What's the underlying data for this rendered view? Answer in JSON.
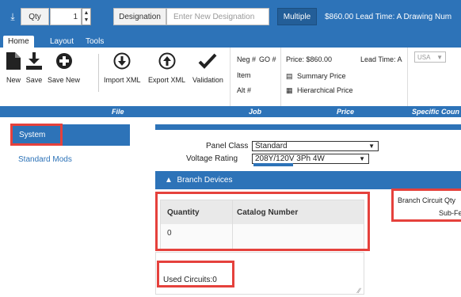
{
  "topbar": {
    "download_icon": "download-icon",
    "qty_label": "Qty",
    "qty_value": "1",
    "designation_label": "Designation",
    "designation_placeholder": "Enter New Designation",
    "multiple_label": "Multiple",
    "info_text": "$860.00  Lead Time: A  Drawing Num"
  },
  "ribbon": {
    "tabs": [
      {
        "label": "Home",
        "active": true
      },
      {
        "label": "Layout",
        "active": false
      },
      {
        "label": "Tools",
        "active": false
      }
    ],
    "file_items": [
      {
        "label": "New",
        "icon": "new-file-icon"
      },
      {
        "label": "Save",
        "icon": "save-download-icon"
      },
      {
        "label": "Save New",
        "icon": "add-circle-icon"
      },
      {
        "label": "Import XML",
        "icon": "import-circle-icon"
      },
      {
        "label": "Export XML",
        "icon": "export-circle-icon"
      },
      {
        "label": "Validation",
        "icon": "checkmark-icon"
      }
    ],
    "job": {
      "neg_label": "Neg #",
      "go_label": "GO #",
      "item_label": "Item",
      "alt_label": "Alt #"
    },
    "price": {
      "price_label": "Price: $860.00",
      "lead_time": "Lead Time: A",
      "summary_price": "Summary Price",
      "hierarchical_price": "Hierarchical Price"
    },
    "specific": {
      "country_value": "USA"
    },
    "group_labels": {
      "file": "File",
      "job": "Job",
      "price": "Price",
      "specific": "Specific Coun"
    }
  },
  "sidebar": {
    "system_label": "System",
    "standard_mods_label": "Standard Mods"
  },
  "main": {
    "panel_class_label": "Panel Class",
    "panel_class_value": "Standard",
    "voltage_label": "Voltage Rating",
    "voltage_value": "208Y/120V 3Ph 4W",
    "branch_devices_label": "Branch Devices",
    "table": {
      "headers": [
        "Quantity",
        "Catalog Number"
      ],
      "rows": [
        [
          "0",
          ""
        ]
      ]
    },
    "used_circuits": "Used Circuits:0",
    "branch_circuit_qty": "Branch Circuit Qty",
    "sub_feed": "Sub-Fe"
  },
  "colors": {
    "brand_blue": "#2d73b8",
    "highlight_red": "#e5413c"
  }
}
